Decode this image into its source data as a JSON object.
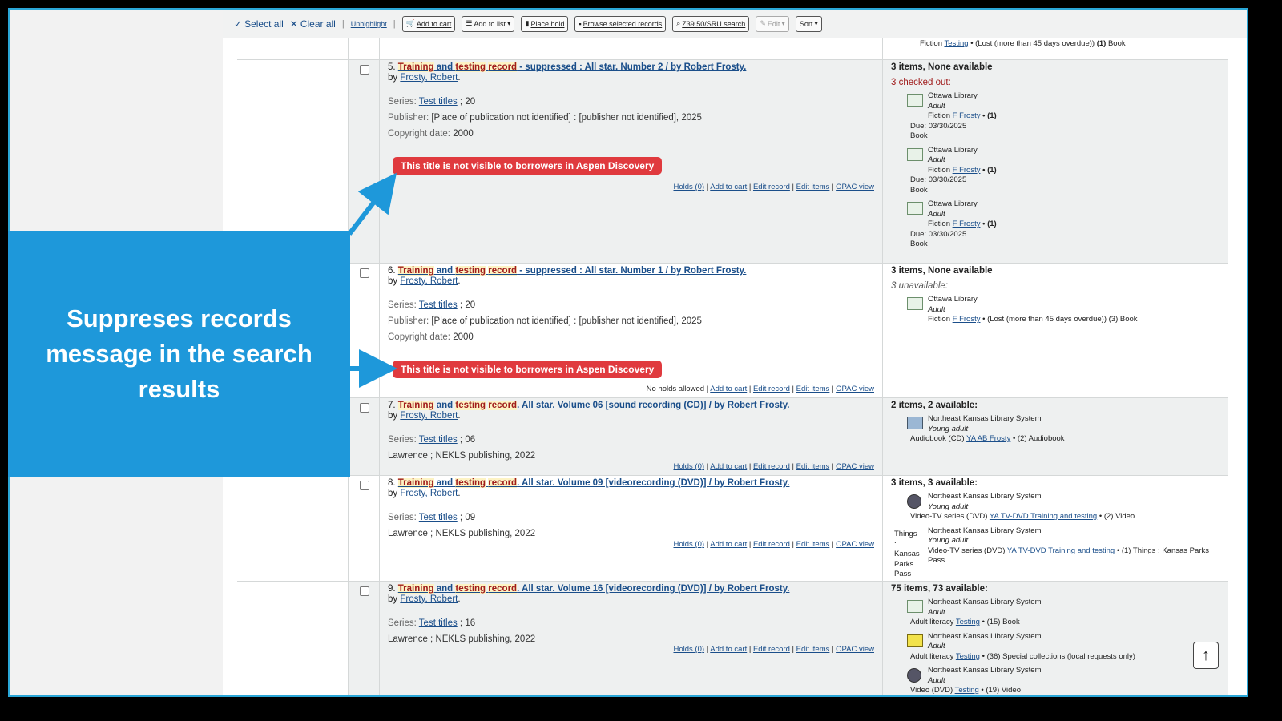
{
  "toolbar": {
    "select_all": "Select all",
    "clear_all": "Clear all",
    "unhighlight": "Unhighlight",
    "add_to_cart": "Add to cart",
    "add_to_list": "Add to list",
    "place_hold": "Place hold",
    "browse_selected": "Browse selected records",
    "z3950": "Z39.50/SRU search",
    "edit": "Edit",
    "sort": "Sort"
  },
  "top_item": {
    "text_prefix": "Fiction ",
    "call_no": "Testing",
    "status": " • (Lost (more than 45 days overdue))",
    "count": " (1) ",
    "type": "Book"
  },
  "callout": {
    "text": "Suppreses records message in the search results"
  },
  "results": [
    {
      "number": "5.",
      "title_parts": [
        "Training",
        " and ",
        "testing",
        " ",
        "record",
        " - suppressed : All star. Number 2 / by Robert Frosty."
      ],
      "by_label": "by",
      "author": "Frosty, Robert",
      "series_label": "Series:",
      "series": "Test titles",
      "series_num": " ; 20",
      "publisher_label": "Publisher:",
      "publisher": "[Place of publication not identified] : [publisher not identified], 2025",
      "copyright_label": "Copyright date:",
      "copyright": "2000",
      "suppress_msg": "This title is not visible to borrowers in Aspen Discovery",
      "actions": [
        "Holds (0)",
        "Add to cart",
        "Edit record",
        "Edit items",
        "OPAC view"
      ],
      "avail_head": "3 items, None available",
      "avail_status": "3 checked out:",
      "items": [
        {
          "library": "Ottawa Library",
          "collection": "Adult",
          "line": "Fiction ",
          "call": "F Frosty",
          "count": " • (1)",
          "due": "Due: 03/30/2025",
          "type": "Book"
        },
        {
          "library": "Ottawa Library",
          "collection": "Adult",
          "line": "Fiction ",
          "call": "F Frosty",
          "count": " • (1)",
          "due": "Due: 03/30/2025",
          "type": "Book"
        },
        {
          "library": "Ottawa Library",
          "collection": "Adult",
          "line": "Fiction ",
          "call": "F Frosty",
          "count": " • (1)",
          "due": "Due: 03/30/2025",
          "type": "Book"
        }
      ]
    },
    {
      "number": "6.",
      "title_parts": [
        "Training",
        " and ",
        "testing",
        " ",
        "record",
        " - suppressed : All star. Number 1 / by Robert Frosty."
      ],
      "by_label": "by",
      "author": "Frosty, Robert",
      "series_label": "Series:",
      "series": "Test titles",
      "series_num": " ; 20",
      "publisher_label": "Publisher:",
      "publisher": "[Place of publication not identified] : [publisher not identified], 2025",
      "copyright_label": "Copyright date:",
      "copyright": "2000",
      "suppress_msg": "This title is not visible to borrowers in Aspen Discovery",
      "no_holds": "No holds allowed",
      "actions": [
        "Add to cart",
        "Edit record",
        "Edit items",
        "OPAC view"
      ],
      "avail_head": "3 items, None available",
      "avail_status": "3 unavailable:",
      "items": [
        {
          "library": "Ottawa Library",
          "collection": "Adult",
          "line": "Fiction ",
          "call": "F Frosty",
          "count": " • (Lost (more than 45 days overdue)) (3) Book"
        }
      ]
    },
    {
      "number": "7.",
      "title_parts": [
        "Training",
        " and ",
        "testing",
        " ",
        "record",
        ". All star. Volume 06 [sound recording (CD)] / by Robert Frosty."
      ],
      "by_label": "by",
      "author": "Frosty, Robert",
      "series_label": "Series:",
      "series": "Test titles",
      "series_num": " ; 06",
      "pub_line": "Lawrence ; NEKLS publishing, 2022",
      "actions": [
        "Holds (0)",
        "Add to cart",
        "Edit record",
        "Edit items",
        "OPAC view"
      ],
      "avail_head": "2 items, 2 available:",
      "items": [
        {
          "library": "Northeast Kansas Library System",
          "collection": "Young adult",
          "line": "Audiobook (CD) ",
          "call": "YA AB Frosty",
          "count": " • (2)  Audiobook"
        }
      ]
    },
    {
      "number": "8.",
      "title_parts": [
        "Training",
        " and ",
        "testing",
        " ",
        "record",
        ". All star. Volume 09 [videorecording (DVD)] / by Robert Frosty."
      ],
      "by_label": "by",
      "author": "Frosty, Robert",
      "series_label": "Series:",
      "series": "Test titles",
      "series_num": " ; 09",
      "pub_line": "Lawrence ; NEKLS publishing, 2022",
      "actions": [
        "Holds (0)",
        "Add to cart",
        "Edit record",
        "Edit items",
        "OPAC view"
      ],
      "avail_head": "3 items, 3 available:",
      "items": [
        {
          "library": "Northeast Kansas Library System",
          "collection": "Young adult",
          "line": "Video-TV series (DVD) ",
          "call": "YA TV-DVD Training and testing",
          "count": " • (2)  Video"
        },
        {
          "library": "Northeast Kansas Library System",
          "collection": "Young adult",
          "line": "Video-TV series (DVD) ",
          "call": "YA TV-DVD Training and testing",
          "count": " • (1)  Things : Kansas Parks Pass"
        }
      ],
      "stray": "Things : Kansas Parks Pass"
    },
    {
      "number": "9.",
      "title_parts": [
        "Training",
        " and ",
        "testing",
        " ",
        "record",
        ". All star. Volume 16 [videorecording (DVD)] / by Robert Frosty."
      ],
      "by_label": "by",
      "author": "Frosty, Robert",
      "series_label": "Series:",
      "series": "Test titles",
      "series_num": " ; 16",
      "pub_line": "Lawrence ; NEKLS publishing, 2022",
      "actions": [
        "Holds (0)",
        "Add to cart",
        "Edit record",
        "Edit items",
        "OPAC view"
      ],
      "avail_head": "75 items, 73 available:",
      "items": [
        {
          "library": "Northeast Kansas Library System",
          "collection": "Adult",
          "line": "Adult literacy ",
          "call": "Testing",
          "count": " • (15)  Book"
        },
        {
          "library": "Northeast Kansas Library System",
          "collection": "Adult",
          "line": "Adult literacy ",
          "call": "Testing",
          "count": " • (36)  Special collections (local requests only)"
        },
        {
          "library": "Northeast Kansas Library System",
          "collection": "Adult",
          "line": "Video (DVD) ",
          "call": "Testing",
          "count": " • (19)  Video"
        }
      ]
    }
  ],
  "back_to_top": "↑"
}
